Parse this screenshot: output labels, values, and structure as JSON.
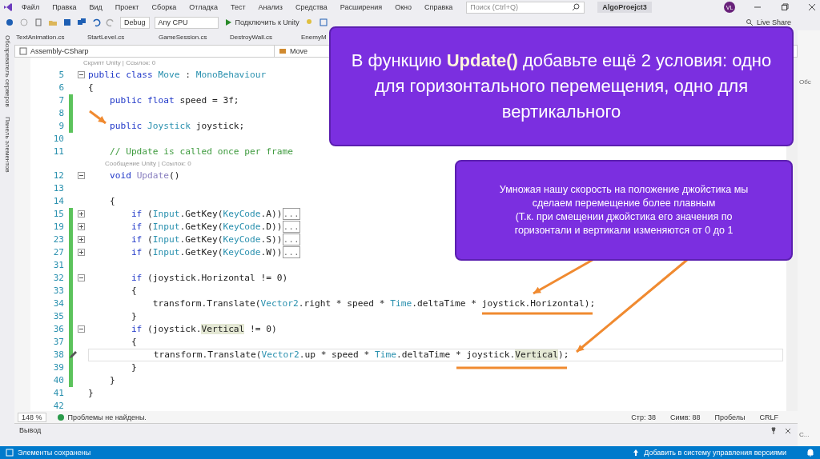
{
  "window": {
    "menu": [
      "Файл",
      "Правка",
      "Вид",
      "Проект",
      "Сборка",
      "Отладка",
      "Тест",
      "Анализ",
      "Средства",
      "Расширения",
      "Окно",
      "Справка"
    ],
    "search": {
      "placeholder": "Поиск (Ctrl+Q)"
    },
    "project": "AlgoProejct3",
    "avatar": "VL"
  },
  "toolbar": {
    "config": "Debug",
    "platform": "Any CPU",
    "run": "Подключить к Unity",
    "live_share": "Live Share"
  },
  "side_panels": [
    "Обозреватель серверов",
    "Панель элементов"
  ],
  "right_panels": [
    "Обс",
    "C..."
  ],
  "tabs": [
    "TextAnimation.cs",
    "StartLevel.cs",
    "GameSession.cs",
    "DestroyWall.cs",
    "EnemyM"
  ],
  "navbar": {
    "project": "Assembly-CSharp",
    "type": "Move"
  },
  "code": [
    {
      "n": "5",
      "expanded": true,
      "changed": false,
      "lens": "Скрипт Unity | Ссылок: 0",
      "t": [
        {
          "kind": "kw",
          "text": "public class "
        },
        {
          "kind": "type",
          "text": "Move"
        },
        {
          "kind": "plain",
          "text": " : "
        },
        {
          "kind": "type",
          "text": "MonoBehaviour"
        }
      ]
    },
    {
      "n": "6",
      "changed": false,
      "t": [
        {
          "kind": "plain",
          "text": "{"
        }
      ]
    },
    {
      "n": "7",
      "changed": true,
      "t": [
        {
          "kind": "kw",
          "text": "    public float "
        },
        {
          "kind": "plain",
          "text": "speed = 3f;"
        }
      ]
    },
    {
      "n": "8",
      "changed": true
    },
    {
      "n": "9",
      "changed": true,
      "t": [
        {
          "kind": "kw",
          "text": "    public "
        },
        {
          "kind": "type",
          "text": "Joystick"
        },
        {
          "kind": "plain",
          "text": " joystick;"
        }
      ]
    },
    {
      "n": "10",
      "changed": false
    },
    {
      "n": "11",
      "changed": false,
      "t": [
        {
          "kind": "comment",
          "text": "    // Update is called once per frame"
        }
      ]
    },
    {
      "n": "12",
      "expanded": true,
      "changed": false,
      "lens": "Сообщение Unity | Ссылок: 0",
      "t": [
        {
          "kind": "kw",
          "text": "    void "
        },
        {
          "kind": "hint",
          "text": "Update"
        },
        {
          "kind": "plain",
          "text": "()"
        }
      ]
    },
    {
      "n": "13",
      "changed": false
    },
    {
      "n": "14",
      "changed": false,
      "t": [
        {
          "kind": "plain",
          "text": "    {"
        }
      ]
    },
    {
      "n": "15",
      "expanded": false,
      "changed": true,
      "t": [
        {
          "kind": "kw",
          "text": "        if "
        },
        {
          "kind": "plain",
          "text": "("
        },
        {
          "kind": "type",
          "text": "Input"
        },
        {
          "kind": "plain",
          "text": ".GetKey("
        },
        {
          "kind": "type",
          "text": "KeyCode"
        },
        {
          "kind": "plain",
          "text": ".A))"
        },
        {
          "kind": "collapsed",
          "text": "..."
        }
      ]
    },
    {
      "n": "19",
      "expanded": false,
      "changed": true,
      "t": [
        {
          "kind": "kw",
          "text": "        if "
        },
        {
          "kind": "plain",
          "text": "("
        },
        {
          "kind": "type",
          "text": "Input"
        },
        {
          "kind": "plain",
          "text": ".GetKey("
        },
        {
          "kind": "type",
          "text": "KeyCode"
        },
        {
          "kind": "plain",
          "text": ".D))"
        },
        {
          "kind": "collapsed",
          "text": "..."
        }
      ]
    },
    {
      "n": "23",
      "expanded": false,
      "changed": true,
      "t": [
        {
          "kind": "kw",
          "text": "        if "
        },
        {
          "kind": "plain",
          "text": "("
        },
        {
          "kind": "type",
          "text": "Input"
        },
        {
          "kind": "plain",
          "text": ".GetKey("
        },
        {
          "kind": "type",
          "text": "KeyCode"
        },
        {
          "kind": "plain",
          "text": ".S))"
        },
        {
          "kind": "collapsed",
          "text": "..."
        }
      ]
    },
    {
      "n": "27",
      "expanded": false,
      "changed": true,
      "t": [
        {
          "kind": "kw",
          "text": "        if "
        },
        {
          "kind": "plain",
          "text": "("
        },
        {
          "kind": "type",
          "text": "Input"
        },
        {
          "kind": "plain",
          "text": ".GetKey("
        },
        {
          "kind": "type",
          "text": "KeyCode"
        },
        {
          "kind": "plain",
          "text": ".W))"
        },
        {
          "kind": "collapsed",
          "text": "..."
        }
      ]
    },
    {
      "n": "31",
      "changed": true
    },
    {
      "n": "32",
      "expanded": true,
      "changed": true,
      "t": [
        {
          "kind": "kw",
          "text": "        if "
        },
        {
          "kind": "plain",
          "text": "(joystick.Horizontal != 0)"
        }
      ]
    },
    {
      "n": "33",
      "changed": true,
      "t": [
        {
          "kind": "plain",
          "text": "        {"
        }
      ]
    },
    {
      "n": "34",
      "changed": true,
      "t": [
        {
          "kind": "plain",
          "text": "            transform.Translate("
        },
        {
          "kind": "type",
          "text": "Vector2"
        },
        {
          "kind": "plain",
          "text": ".right * speed * "
        },
        {
          "kind": "type",
          "text": "Time"
        },
        {
          "kind": "plain",
          "text": ".deltaTime * joystick.Horizontal);"
        }
      ]
    },
    {
      "n": "35",
      "changed": true,
      "t": [
        {
          "kind": "plain",
          "text": "        }"
        }
      ]
    },
    {
      "n": "36",
      "expanded": true,
      "changed": true,
      "t": [
        {
          "kind": "kw",
          "text": "        if "
        },
        {
          "kind": "plain",
          "text": "(joystick."
        },
        {
          "kind": "ref",
          "text": "Vertical"
        },
        {
          "kind": "plain",
          "text": " != 0)"
        }
      ]
    },
    {
      "n": "37",
      "changed": true,
      "t": [
        {
          "kind": "plain",
          "text": "        {"
        }
      ]
    },
    {
      "n": "38",
      "changed": true,
      "current": true,
      "t": [
        {
          "kind": "plain",
          "text": "            transform.Translate("
        },
        {
          "kind": "type",
          "text": "Vector2"
        },
        {
          "kind": "plain",
          "text": ".up * speed * "
        },
        {
          "kind": "type",
          "text": "Time"
        },
        {
          "kind": "plain",
          "text": ".deltaTime * joystick."
        },
        {
          "kind": "ref",
          "text": "Vertical"
        },
        {
          "kind": "plain",
          "text": ");"
        }
      ]
    },
    {
      "n": "39",
      "changed": true,
      "t": [
        {
          "kind": "plain",
          "text": "        }"
        }
      ]
    },
    {
      "n": "40",
      "changed": true,
      "t": [
        {
          "kind": "plain",
          "text": "    }"
        }
      ]
    },
    {
      "n": "41",
      "changed": false,
      "t": [
        {
          "kind": "plain",
          "text": "}"
        }
      ]
    },
    {
      "n": "42",
      "changed": false
    }
  ],
  "editor_status": {
    "zoom": "148 %",
    "issues": "Проблемы не найдены.",
    "line": "Стр: 38",
    "col": "Симв: 88",
    "spaces": "Пробелы",
    "eol": "CRLF"
  },
  "output": {
    "title": "Вывод"
  },
  "status_bar": {
    "message": "Элементы сохранены",
    "vcs": "Добавить в систему управления версиями"
  },
  "callouts": [
    {
      "text": "В функцию **Update()** добавьте ещё 2 условия: одно для горизонтального перемещения, одно для вертикального"
    },
    {
      "text": "Умножая нашу скорость на положение джойстика мы\nсделаем перемещение более плавным\n(Т.к. при смещении джойстика его значения по\nгоризонтали и вертикали изменяются от 0 до 1"
    }
  ]
}
